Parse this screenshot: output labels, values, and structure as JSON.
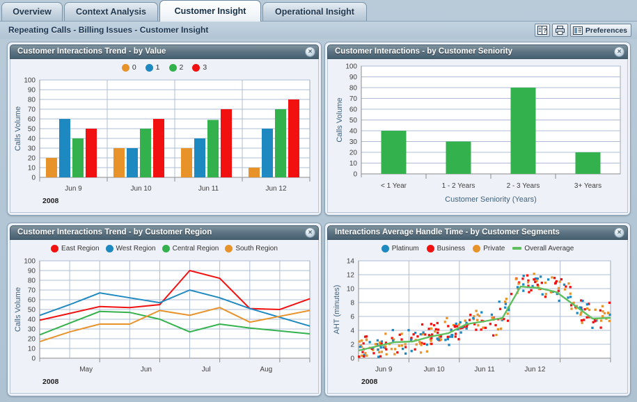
{
  "tabs": [
    {
      "label": "Overview",
      "active": false
    },
    {
      "label": "Context Analysis",
      "active": false
    },
    {
      "label": "Customer Insight",
      "active": true
    },
    {
      "label": "Operational Insight",
      "active": false
    }
  ],
  "breadcrumb": "Repeating Calls - Billing Issues - Customer Insight",
  "toolbar": {
    "help_icon": "help-book-icon",
    "print_icon": "printer-icon",
    "preferences_icon": "preferences-icon",
    "preferences_label": "Preferences"
  },
  "colors": {
    "orange": "#e8922a",
    "blue": "#1e88c0",
    "green": "#33b14c",
    "red": "#f21111",
    "line_green": "#5fbf5f"
  },
  "panels": [
    {
      "title": "Customer Interactions Trend - by Value",
      "close_label": "×"
    },
    {
      "title": "Customer Interactions - by Customer Seniority",
      "close_label": "×"
    },
    {
      "title": "Customer Interactions Trend - by Customer Region",
      "close_label": "×"
    },
    {
      "title": "Interactions Average Handle Time - by Customer Segments",
      "close_label": "×"
    }
  ],
  "chart_data": [
    {
      "id": "interactions-by-value",
      "type": "bar",
      "title": "Customer Interactions Trend - by Value",
      "xlabel": "2008",
      "ylabel": "Calls Volume",
      "ylim": [
        0,
        100
      ],
      "yticks": [
        0,
        10,
        20,
        30,
        40,
        50,
        60,
        70,
        80,
        90,
        100
      ],
      "grid": true,
      "legend_position": "top",
      "categories": [
        "Jun 9",
        "Jun 10",
        "Jun 11",
        "Jun 12"
      ],
      "series": [
        {
          "name": "0",
          "color": "#e8922a",
          "values": [
            20,
            30,
            30,
            10
          ]
        },
        {
          "name": "1",
          "color": "#1e88c0",
          "values": [
            60,
            30,
            40,
            50
          ]
        },
        {
          "name": "2",
          "color": "#33b14c",
          "values": [
            40,
            50,
            59,
            70
          ]
        },
        {
          "name": "3",
          "color": "#f21111",
          "values": [
            50,
            60,
            70,
            80
          ]
        }
      ]
    },
    {
      "id": "interactions-by-seniority",
      "type": "bar",
      "title": "Customer Interactions - by Customer Seniority",
      "xlabel": "Customer Seniority (Years)",
      "ylabel": "Calls Volume",
      "ylim": [
        0,
        100
      ],
      "yticks": [
        0,
        10,
        20,
        30,
        40,
        50,
        60,
        70,
        80,
        90,
        100
      ],
      "grid": true,
      "legend_position": "none",
      "categories": [
        "< 1 Year",
        "1 - 2 Years",
        "2 - 3 Years",
        "3+ Years"
      ],
      "series": [
        {
          "name": "Calls Volume",
          "color": "#33b14c",
          "values": [
            40,
            30,
            80,
            20
          ]
        }
      ]
    },
    {
      "id": "interactions-by-region",
      "type": "line",
      "title": "Customer Interactions Trend - by Customer Region",
      "xlabel": "2008",
      "ylabel": "Calls Volume",
      "ylim": [
        0,
        100
      ],
      "yticks": [
        0,
        10,
        20,
        30,
        40,
        50,
        60,
        70,
        80,
        90,
        100
      ],
      "grid": true,
      "legend_position": "top",
      "xticks": [
        "May",
        "Jun",
        "Jul",
        "Aug"
      ],
      "x": [
        0,
        1,
        2,
        3,
        4,
        5,
        6,
        7,
        8,
        9
      ],
      "series": [
        {
          "name": "East Region",
          "color": "#f21111",
          "values": [
            39,
            46,
            53,
            52,
            55,
            90,
            82,
            51,
            50,
            61
          ]
        },
        {
          "name": "West Region",
          "color": "#1e88c0",
          "values": [
            44,
            55,
            67,
            62,
            57,
            70,
            62,
            51,
            42,
            33
          ]
        },
        {
          "name": "Central Region",
          "color": "#33b14c",
          "values": [
            24,
            36,
            48,
            47,
            40,
            27,
            35,
            31,
            28,
            25
          ]
        },
        {
          "name": "South Region",
          "color": "#e8922a",
          "values": [
            17,
            27,
            35,
            35,
            49,
            44,
            52,
            37,
            43,
            49
          ]
        }
      ]
    },
    {
      "id": "aht-by-segments",
      "type": "scatter",
      "title": "Interactions Average Handle Time - by Customer Segments",
      "xlabel": "2008",
      "ylabel": "AHT (minutes)",
      "ylim": [
        0,
        14
      ],
      "yticks": [
        0,
        2,
        4,
        6,
        8,
        10,
        12,
        14
      ],
      "grid": true,
      "legend_position": "top",
      "xticks": [
        "Jun 9",
        "Jun 10",
        "Jun 11",
        "Jun 12"
      ],
      "series": [
        {
          "name": "Platinum",
          "color": "#1e88c0",
          "marker": "dot"
        },
        {
          "name": "Business",
          "color": "#f21111",
          "marker": "dot"
        },
        {
          "name": "Private",
          "color": "#e8922a",
          "marker": "dot"
        },
        {
          "name": "Overall Average",
          "color": "#5fbf5f",
          "marker": "line",
          "values": [
            1.1,
            1.7,
            2.3,
            2.4,
            3.1,
            3.6,
            4.9,
            5.3,
            5.8,
            10.3,
            10.1,
            9.5,
            7.6,
            5.7,
            5.8
          ]
        }
      ]
    }
  ]
}
